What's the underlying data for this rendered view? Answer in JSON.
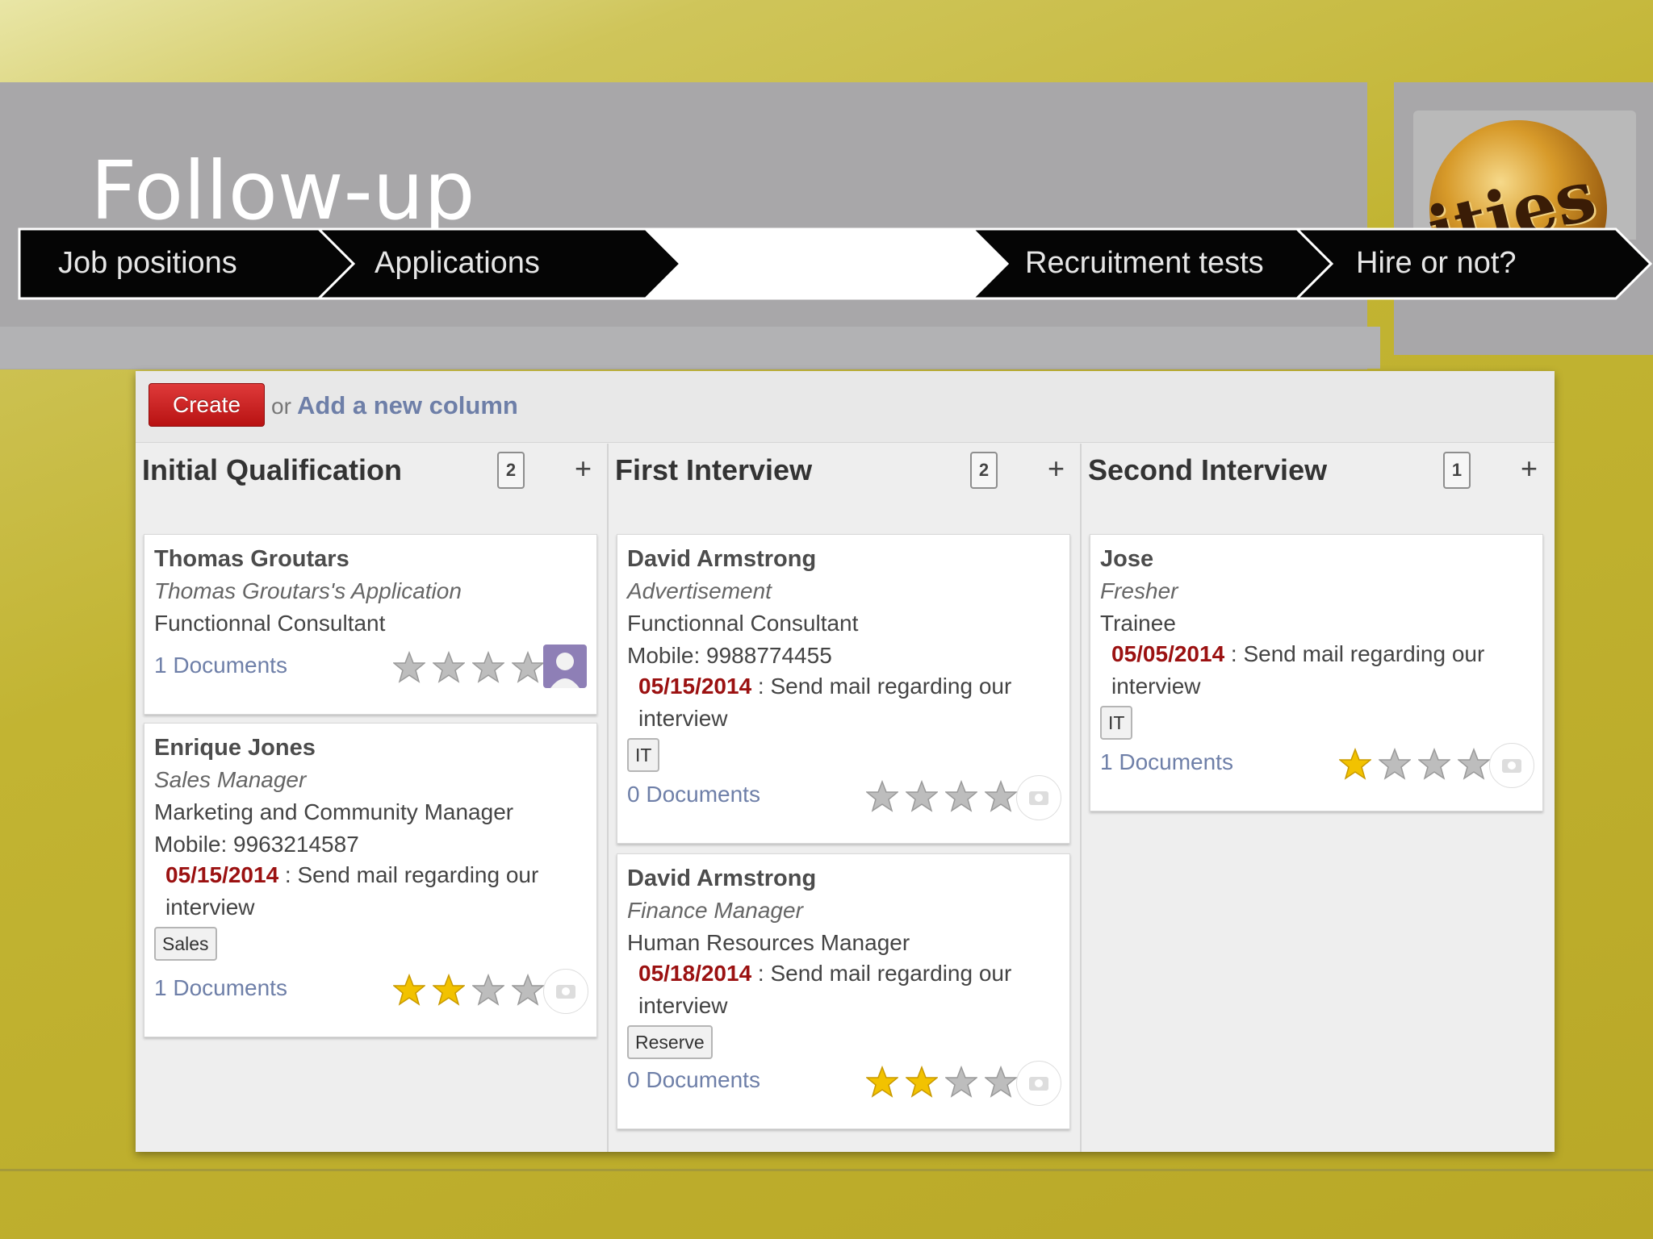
{
  "slide": {
    "title": "Follow-up",
    "logo_text": "ities",
    "steps": [
      "Job positions",
      "Applications",
      "",
      "Recruitment tests",
      "Hire or not?"
    ]
  },
  "toolbar": {
    "create_label": "Create",
    "or_label": "or",
    "add_column_label": "Add a new column"
  },
  "columns": [
    {
      "title": "Initial Qualification",
      "count": "2",
      "cards": [
        {
          "name": "Thomas Groutars",
          "subtitle": "Thomas Groutars's Application",
          "position": "Functionnal Consultant",
          "docs": "1 Documents",
          "rating": 0
        },
        {
          "name": "Enrique Jones",
          "subtitle": "Sales Manager",
          "position": "Marketing and Community Manager",
          "mobile": "Mobile: 9963214587",
          "date": "05/15/2014",
          "activity": " : Send mail regarding our interview",
          "tag": "Sales",
          "docs": "1 Documents",
          "rating": 2
        }
      ]
    },
    {
      "title": "First Interview",
      "count": "2",
      "cards": [
        {
          "name": "David Armstrong",
          "subtitle": "Advertisement",
          "position": "Functionnal Consultant",
          "mobile": "Mobile: 9988774455",
          "date": "05/15/2014",
          "activity": " : Send mail regarding our interview",
          "tag": "IT",
          "docs": "0 Documents",
          "rating": 0
        },
        {
          "name": "David Armstrong",
          "subtitle": "Finance Manager",
          "position": "Human Resources Manager",
          "date": "05/18/2014",
          "activity": " : Send mail regarding our interview",
          "tag": "Reserve",
          "docs": "0 Documents",
          "rating": 2
        }
      ]
    },
    {
      "title": "Second Interview",
      "count": "1",
      "cards": [
        {
          "name": "Jose",
          "subtitle": "Fresher",
          "position": "Trainee",
          "date": "05/05/2014",
          "activity": " : Send mail regarding our interview",
          "tag": "IT",
          "docs": "1 Documents",
          "rating": 1
        }
      ]
    }
  ],
  "colors": {
    "create_button": "#c41a1a",
    "link": "#6e7fa8",
    "date": "#9b1111",
    "star_on": "#f2c200",
    "star_off": "#bdbdbd"
  }
}
